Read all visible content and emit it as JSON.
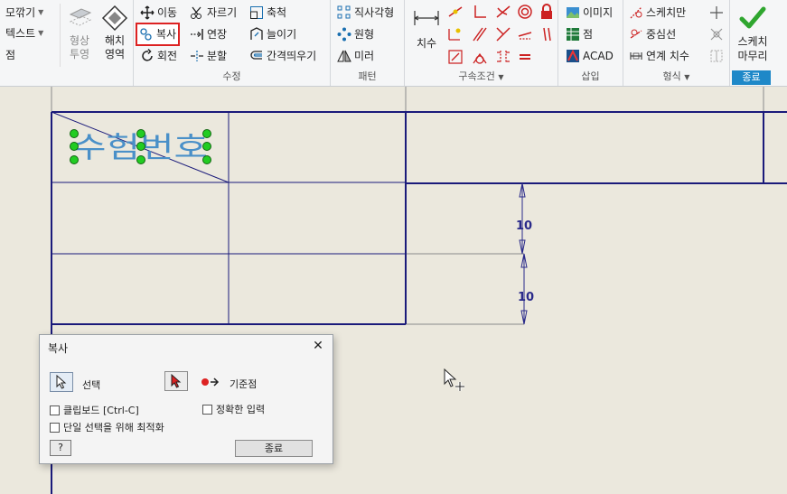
{
  "ribbon": {
    "create_group": {
      "items": [
        "모깎기",
        "텍스트",
        "점"
      ],
      "projection_label": "형상\n투영",
      "hatch_label": "해치\n영역"
    },
    "modify_group": {
      "title": "수정",
      "move": "이동",
      "trim": "자르기",
      "scale": "축척",
      "copy": "복사",
      "extend": "연장",
      "stretch": "늘이기",
      "rotate": "회전",
      "split": "분할",
      "offset": "간격띄우기"
    },
    "pattern_group": {
      "title": "패턴",
      "rect": "직사각형",
      "circular": "원형",
      "mirror": "미러"
    },
    "constraint_group": {
      "title": "구속조건",
      "dimension": "치수"
    },
    "insert_group": {
      "title": "삽입",
      "image": "이미지",
      "point": "점",
      "acad": "ACAD"
    },
    "format_group": {
      "title": "형식",
      "sketch_only": "스케치만",
      "centerline": "중심선",
      "linked_dimension": "연계 치수"
    },
    "finish_group": {
      "title": "종료",
      "finish_label_1": "스케치",
      "finish_label_2": "마무리"
    }
  },
  "canvas": {
    "sketch_text": "수험번호",
    "dimension_1": "10",
    "dimension_2": "10"
  },
  "dialog": {
    "title": "복사",
    "select_label": "선택",
    "base_point_label": "기준점",
    "clipboard_label": "클립보드 [Ctrl-C]",
    "precise_input_label": "정확한 입력",
    "optimize_label": "단일 선택을 위해 최적화",
    "close_button": "종료",
    "help_button": "?"
  },
  "colors": {
    "accent": "#1e88c8",
    "sketch_line": "#1a1a7a",
    "canvas_bg": "#ebe8dd",
    "grip": "#22cc22",
    "highlight": "#d22222"
  }
}
